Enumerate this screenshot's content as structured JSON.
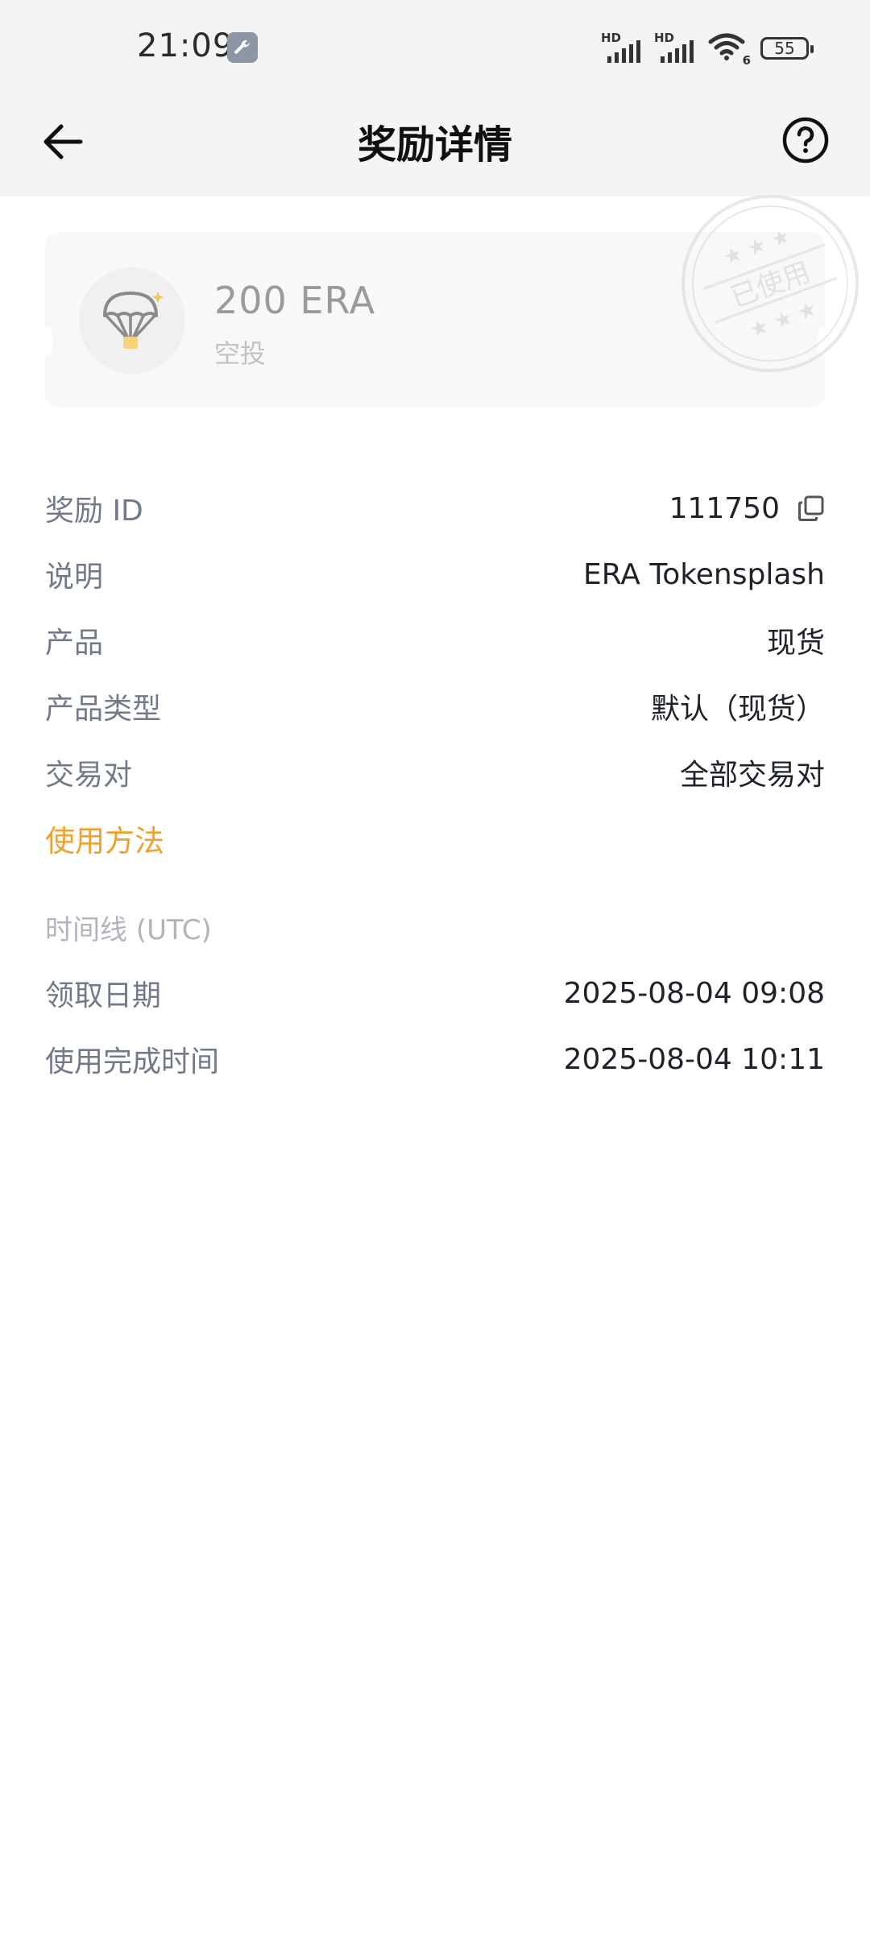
{
  "status_bar": {
    "time": "21:09",
    "signal1_label": "HD",
    "signal2_label": "HD",
    "wifi_label": "6",
    "battery": "55"
  },
  "header": {
    "title": "奖励详情"
  },
  "card": {
    "amount": "200 ERA",
    "type": "空投",
    "stamp_text": "已使用",
    "icon": "parachute-icon"
  },
  "details": {
    "reward_id_label": "奖励 ID",
    "reward_id_value": "111750",
    "description_label": "说明",
    "description_value": "ERA Tokensplash",
    "product_label": "产品",
    "product_value": "现货",
    "product_type_label": "产品类型",
    "product_type_value": "默认（现货）",
    "pair_label": "交易对",
    "pair_value": "全部交易对",
    "how_to_use": "使用方法"
  },
  "timeline": {
    "title": "时间线 (UTC)",
    "claim_label": "领取日期",
    "claim_value": "2025-08-04 09:08",
    "completed_label": "使用完成时间",
    "completed_value": "2025-08-04 10:11"
  },
  "colors": {
    "accent": "#f0a030",
    "label": "#707a8a",
    "value": "#1e2329"
  }
}
